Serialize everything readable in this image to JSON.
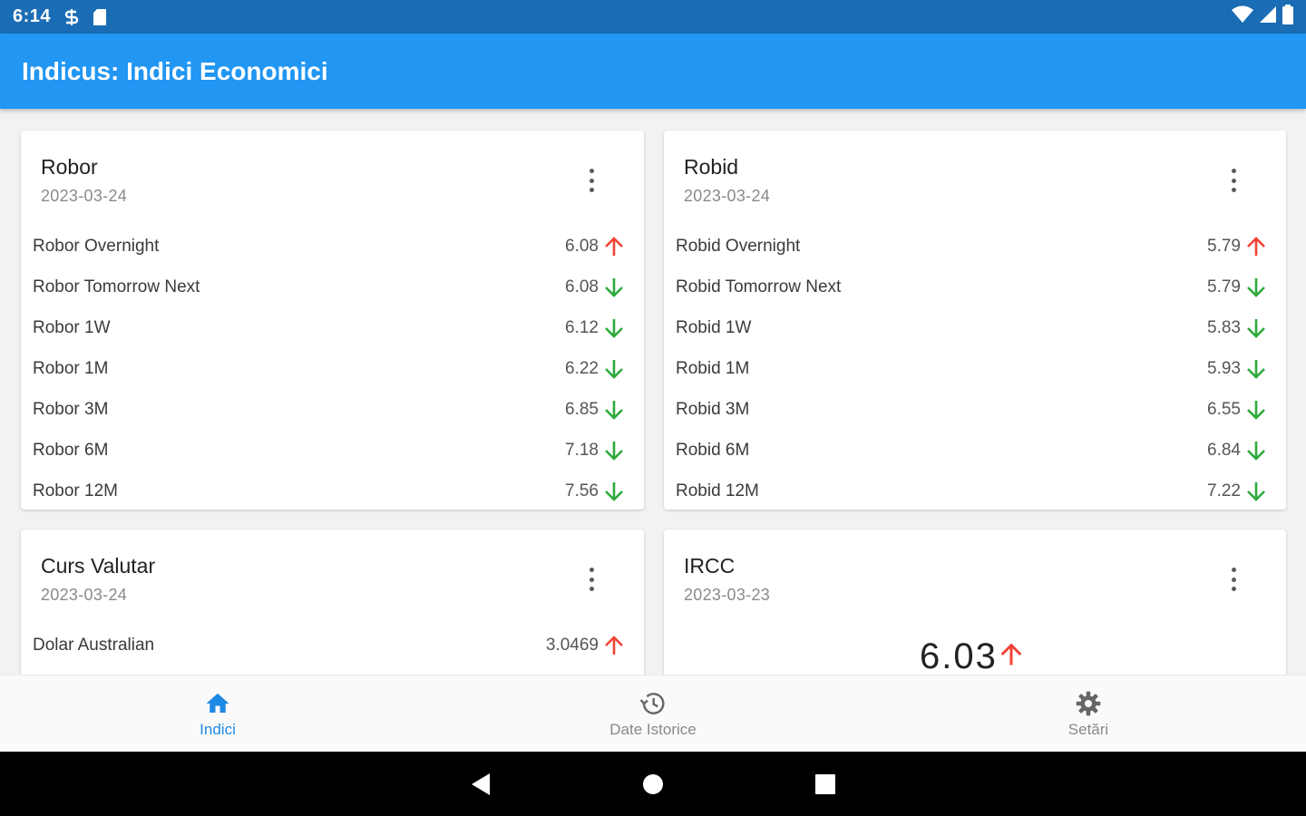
{
  "status_bar": {
    "time": "6:14"
  },
  "app_bar": {
    "title": "Indicus: Indici Economici"
  },
  "colors": {
    "app_bar": "#2196f3",
    "status_bar": "#1a6db5",
    "up": "#f44336",
    "down": "#2eaa3c",
    "active_nav": "#1e88e5"
  },
  "cards": {
    "robor": {
      "title": "Robor",
      "date": "2023-03-24",
      "rows": [
        {
          "label": "Robor Overnight",
          "value": "6.08",
          "trend": "up"
        },
        {
          "label": "Robor Tomorrow Next",
          "value": "6.08",
          "trend": "down"
        },
        {
          "label": "Robor 1W",
          "value": "6.12",
          "trend": "down"
        },
        {
          "label": "Robor 1M",
          "value": "6.22",
          "trend": "down"
        },
        {
          "label": "Robor 3M",
          "value": "6.85",
          "trend": "down"
        },
        {
          "label": "Robor 6M",
          "value": "7.18",
          "trend": "down"
        },
        {
          "label": "Robor 12M",
          "value": "7.56",
          "trend": "down"
        }
      ]
    },
    "robid": {
      "title": "Robid",
      "date": "2023-03-24",
      "rows": [
        {
          "label": "Robid Overnight",
          "value": "5.79",
          "trend": "up"
        },
        {
          "label": "Robid Tomorrow Next",
          "value": "5.79",
          "trend": "down"
        },
        {
          "label": "Robid 1W",
          "value": "5.83",
          "trend": "down"
        },
        {
          "label": "Robid 1M",
          "value": "5.93",
          "trend": "down"
        },
        {
          "label": "Robid 3M",
          "value": "6.55",
          "trend": "down"
        },
        {
          "label": "Robid 6M",
          "value": "6.84",
          "trend": "down"
        },
        {
          "label": "Robid 12M",
          "value": "7.22",
          "trend": "down"
        }
      ]
    },
    "curs": {
      "title": "Curs Valutar",
      "date": "2023-03-24",
      "rows": [
        {
          "label": "Dolar Australian",
          "value": "3.0469",
          "trend": "up"
        }
      ]
    },
    "ircc": {
      "title": "IRCC",
      "date": "2023-03-23",
      "value": "6.03",
      "trend": "up"
    }
  },
  "bottom_nav": {
    "items": [
      {
        "label": "Indici",
        "icon": "home-icon",
        "active": true
      },
      {
        "label": "Date Istorice",
        "icon": "history-icon",
        "active": false
      },
      {
        "label": "Setări",
        "icon": "settings-icon",
        "active": false
      }
    ]
  }
}
